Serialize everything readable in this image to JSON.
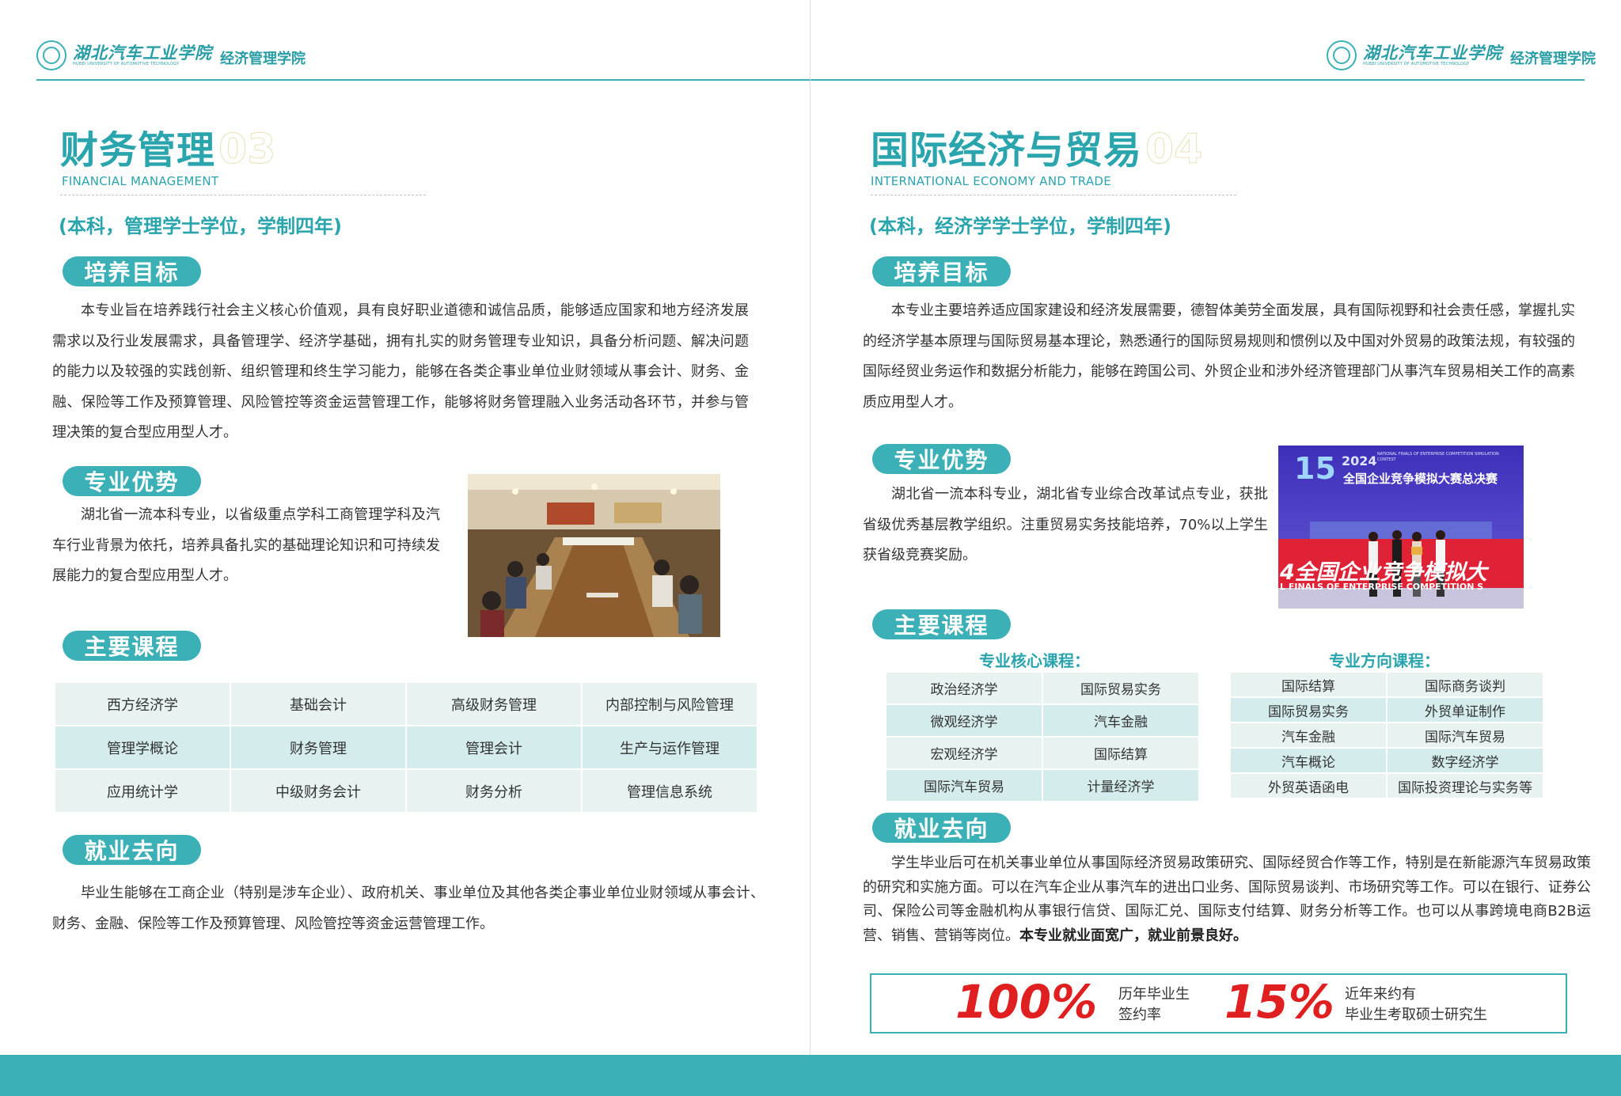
{
  "header": {
    "university_cn": "湖北汽车工业学院",
    "university_en": "HUBEI UNIVERSITY OF AUTOMOTIVE TECHNOLOGY",
    "college": "经济管理学院"
  },
  "left": {
    "title": "财务管理",
    "number": "03",
    "title_en": "FINANCIAL MANAGEMENT",
    "degree": "(本科，管理学士学位，学制四年)",
    "sections": {
      "goal": "培养目标",
      "advantage": "专业优势",
      "courses": "主要课程",
      "career": "就业去向"
    },
    "goal_text": "本专业旨在培养践行社会主义核心价值观，具有良好职业道德和诚信品质，能够适应国家和地方经济发展需求以及行业发展需求，具备管理学、经济学基础，拥有扎实的财务管理专业知识，具备分析问题、解决问题的能力以及较强的实践创新、组织管理和终生学习能力，能够在各类企事业单位业财领域从事会计、财务、金融、保险等工作及预算管理、风险管控等资金运营管理工作，能够将财务管理融入业务活动各环节，并参与管理决策的复合型应用型人才。",
    "advantage_text": "湖北省一流本科专业，以省级重点学科工商管理学科及汽车行业背景为依托，培养具备扎实的基础理论知识和可持续发展能力的复合型应用型人才。",
    "course_table": [
      [
        "西方经济学",
        "基础会计",
        "高级财务管理",
        "内部控制与风险管理"
      ],
      [
        "管理学概论",
        "财务管理",
        "管理会计",
        "生产与运作管理"
      ],
      [
        "应用统计学",
        "中级财务会计",
        "财务分析",
        "管理信息系统"
      ]
    ],
    "career_text": "毕业生能够在工商企业（特别是涉车企业）、政府机关、事业单位及其他各类企事业单位业财领域从事会计、财务、金融、保险等工作及预算管理、风险管控等资金运营管理工作。"
  },
  "right": {
    "title": "国际经济与贸易",
    "number": "04",
    "title_en": "INTERNATIONAL ECONOMY AND TRADE",
    "degree": "(本科，经济学学士学位，学制四年)",
    "sections": {
      "goal": "培养目标",
      "advantage": "专业优势",
      "courses": "主要课程",
      "career": "就业去向"
    },
    "goal_text": "本专业主要培养适应国家建设和经济发展需要，德智体美劳全面发展，具有国际视野和社会责任感，掌握扎实的经济学基本原理与国际贸易基本理论，熟悉通行的国际贸易规则和惯例以及中国对外贸易的政策法规，有较强的国际经贸业务运作和数据分析能力，能够在跨国公司、外贸企业和涉外经济管理部门从事汽车贸易相关工作的高素质应用型人才。",
    "advantage_text": "湖北省一流本科专业，湖北省专业综合改革试点专业，获批省级优秀基层教学组织。注重贸易实务技能培养，70%以上学生获省级竞赛奖励。",
    "photo_banner": {
      "year": "2024",
      "heading": "全国企业竞争模拟大赛总决赛",
      "small_en": "NATIONAL FINALS OF ENTERPRISE COMPETITION SIMULATION CONTEST",
      "red_band": "4全国企业竞争模拟大",
      "red_band_en": "L FINALS OF ENTERPRISE COMPETITION S"
    },
    "core_head": "专业核心课程：",
    "core_courses": [
      [
        "政治经济学",
        "国际贸易实务"
      ],
      [
        "微观经济学",
        "汽车金融"
      ],
      [
        "宏观经济学",
        "国际结算"
      ],
      [
        "国际汽车贸易",
        "计量经济学"
      ]
    ],
    "direction_head": "专业方向课程：",
    "direction_courses": [
      [
        "国际结算",
        "国际商务谈判"
      ],
      [
        "国际贸易实务",
        "外贸单证制作"
      ],
      [
        "汽车金融",
        "国际汽车贸易"
      ],
      [
        "汽车概论",
        "数字经济学"
      ],
      [
        "外贸英语函电",
        "国际投资理论与实务等"
      ]
    ],
    "career_text": "学生毕业后可在机关事业单位从事国际经济贸易政策研究、国际经贸合作等工作，特别是在新能源汽车贸易政策的研究和实施方面。可以在汽车企业从事汽车的进出口业务、国际贸易谈判、市场研究等工作。可以在银行、证券公司、保险公司等金融机构从事银行信贷、国际汇兑、国际支付结算、财务分析等工作。也可以从事跨境电商B2B运营、销售、营销等岗位。",
    "career_bold": "本专业就业面宽广，就业前景良好。",
    "stats": [
      {
        "value": "100%",
        "label1": "历年毕业生",
        "label2": "签约率"
      },
      {
        "value": "15%",
        "label1": "近年来约有",
        "label2": "毕业生考取硕士研究生"
      }
    ]
  },
  "colors": {
    "accent": "#3bb0b7",
    "title": "#2aa4ad",
    "stat": "#e02020"
  }
}
